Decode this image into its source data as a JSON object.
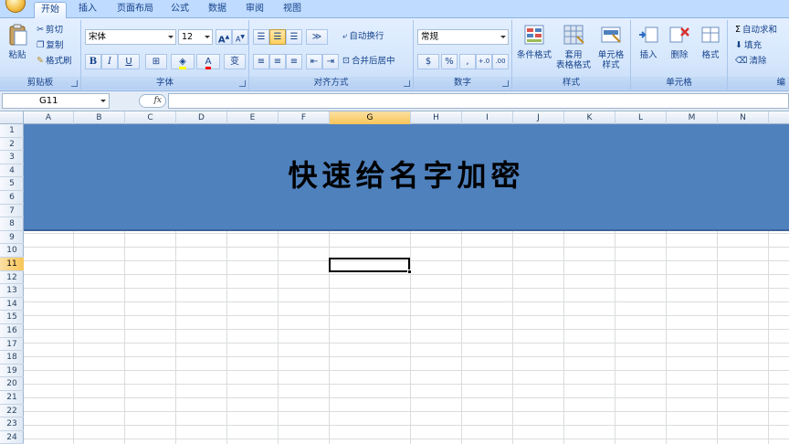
{
  "tabs": [
    {
      "label": "开始",
      "active": true
    },
    {
      "label": "插入"
    },
    {
      "label": "页面布局"
    },
    {
      "label": "公式"
    },
    {
      "label": "数据"
    },
    {
      "label": "审阅"
    },
    {
      "label": "视图"
    }
  ],
  "ribbon": {
    "clipboard": {
      "paste": "粘贴",
      "cut": "剪切",
      "copy": "复制",
      "format_painter": "格式刷",
      "label": "剪贴板"
    },
    "font": {
      "name": "宋体",
      "size": "12",
      "bold": "B",
      "italic": "I",
      "underline": "U",
      "grow": "A",
      "shrink": "A",
      "label": "字体",
      "phonetic": "变"
    },
    "alignment": {
      "wrap": "自动换行",
      "merge": "合并后居中",
      "label": "对齐方式"
    },
    "number": {
      "format": "常规",
      "percent": "%",
      "comma": ",",
      "inc_decimal": "+.0",
      "dec_decimal": ".00",
      "label": "数字"
    },
    "styles": {
      "conditional": "条件格式",
      "table_line1": "套用",
      "table_line2": "表格格式",
      "cell_line1": "单元格",
      "cell_line2": "样式",
      "label": "样式"
    },
    "cells": {
      "insert": "插入",
      "delete": "删除",
      "format": "格式",
      "label": "单元格"
    },
    "editing": {
      "autosum": "自动求和",
      "fill": "填充",
      "clear": "清除",
      "label": "编"
    }
  },
  "formula_bar": {
    "name_box": "G11",
    "fx": "fx",
    "formula": ""
  },
  "columns": [
    "A",
    "B",
    "C",
    "D",
    "E",
    "F",
    "G",
    "H",
    "I",
    "J",
    "K",
    "L",
    "M",
    "N"
  ],
  "rows": [
    "1",
    "2",
    "3",
    "4",
    "5",
    "6",
    "7",
    "8",
    "9",
    "10",
    "11",
    "12",
    "13",
    "14",
    "15",
    "16",
    "17",
    "18",
    "19",
    "20",
    "21",
    "22",
    "23",
    "24"
  ],
  "selected": {
    "column": "G",
    "row": "11"
  },
  "sheet": {
    "banner_text": "快速给名字加密"
  },
  "colors": {
    "banner": "#4f81bd",
    "ribbon": "#dbe7fb",
    "selection_header": "#f8c558"
  }
}
